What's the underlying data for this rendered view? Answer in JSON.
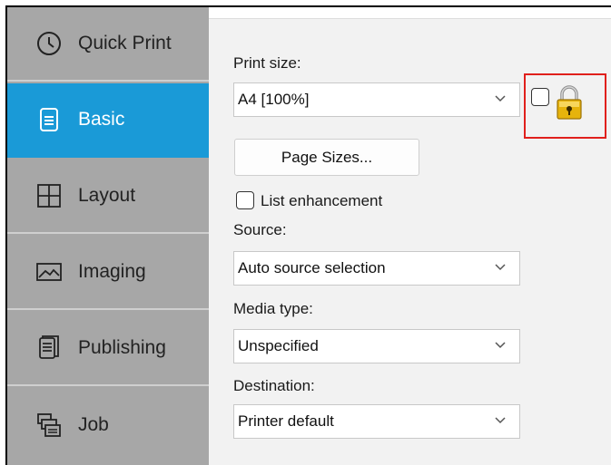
{
  "sidebar": {
    "items": [
      {
        "label": "Quick Print",
        "icon": "clock-icon",
        "active": false
      },
      {
        "label": "Basic",
        "icon": "document-icon",
        "active": true
      },
      {
        "label": "Layout",
        "icon": "layout-grid-icon",
        "active": false
      },
      {
        "label": "Imaging",
        "icon": "image-icon",
        "active": false
      },
      {
        "label": "Publishing",
        "icon": "publishing-icon",
        "active": false
      },
      {
        "label": "Job",
        "icon": "job-stack-icon",
        "active": false
      }
    ]
  },
  "basic": {
    "print_size": {
      "label": "Print size:",
      "value": "A4  [100%]"
    },
    "page_sizes_button": "Page Sizes...",
    "list_enhancement": {
      "label": "List enhancement",
      "checked": false
    },
    "source": {
      "label": "Source:",
      "value": "Auto source selection"
    },
    "media_type": {
      "label": "Media type:",
      "value": "Unspecified"
    },
    "destination": {
      "label": "Destination:",
      "value": "Printer default"
    },
    "lock_checkbox": {
      "checked": false,
      "icon": "padlock-icon"
    }
  },
  "colors": {
    "sidebar_bg": "#a7a7a7",
    "active_bg": "#1a9ad7",
    "panel_bg": "#f2f2f2",
    "highlight": "#e0201c"
  }
}
